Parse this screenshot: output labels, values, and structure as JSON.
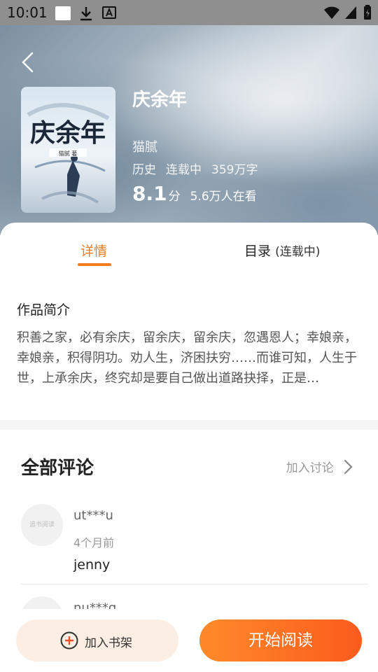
{
  "status_bar": {
    "time": "10:01"
  },
  "book": {
    "title": "庆余年",
    "author": "猫腻",
    "genre": "历史",
    "status": "连载中",
    "word_count": "359万字",
    "rating": "8.1",
    "rating_unit": "分",
    "readers": "5.6万人在看",
    "cover_title": "庆余年",
    "cover_author": "猫腻 著"
  },
  "tabs": {
    "detail": "详情",
    "toc": "目录",
    "toc_status": "(连载中)"
  },
  "intro": {
    "heading": "作品简介",
    "text": "积善之家，必有余庆，留余庆，留余庆，忽遇恩人；幸娘亲，幸娘亲，积得阴功。劝人生，济困扶穷……而谁可知，人生于世，上承余庆，终究却是要自己做出道路抉择，正是…"
  },
  "comments": {
    "title": "全部评论",
    "join_label": "加入讨论",
    "items": [
      {
        "user": "ut***u",
        "time": "4个月前",
        "text": "jenny",
        "avatar_text": "追书阅读"
      },
      {
        "user": "nu***q"
      }
    ]
  },
  "bottom": {
    "add_shelf": "加入书架",
    "start_read": "开始阅读"
  },
  "colors": {
    "accent": "#f47b20",
    "cta_start": "#ff8a2a",
    "cta_end": "#fb5b1d"
  }
}
